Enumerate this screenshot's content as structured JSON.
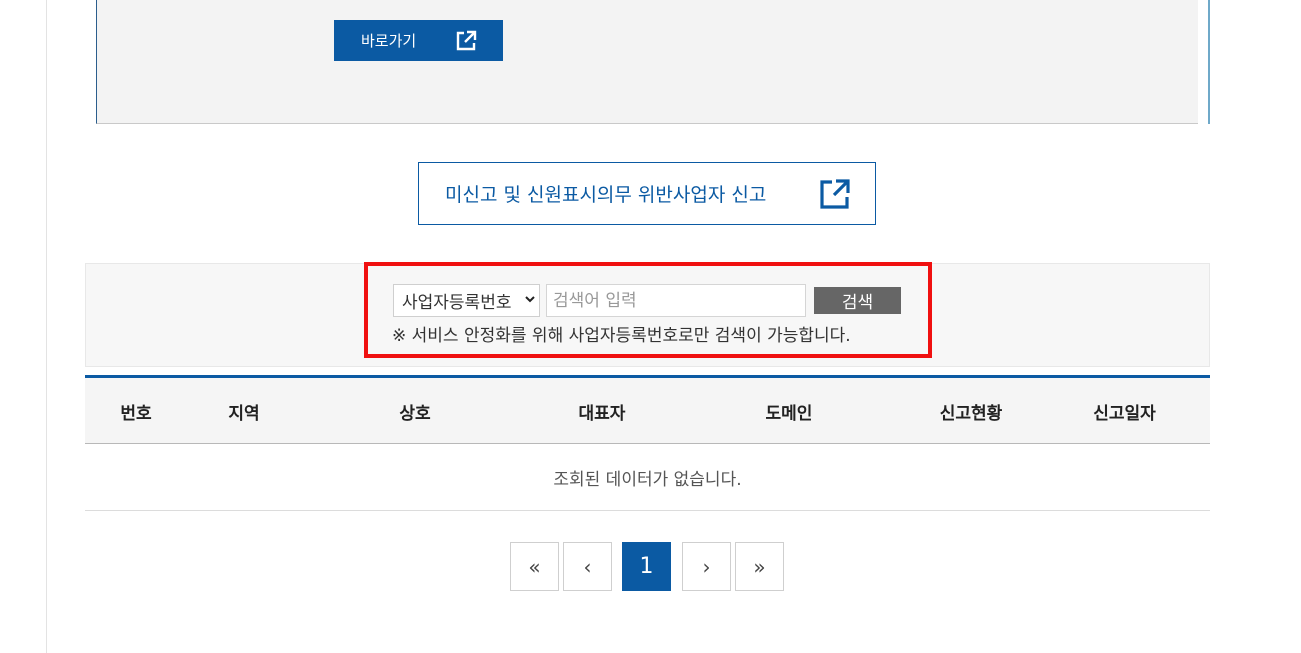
{
  "info_box": {
    "go_button_label": "바로가기",
    "go_icon": "external-link-icon"
  },
  "report_button": {
    "label": "미신고 및 신원표시의무 위반사업자 신고",
    "icon": "external-link-icon"
  },
  "search": {
    "select_value": "사업자등록번호",
    "input_placeholder": "검색어 입력",
    "input_value": "",
    "button_label": "검색",
    "note": "※ 서비스 안정화를 위해 사업자등록번호로만 검색이 가능합니다.",
    "highlight_color": "#f01010"
  },
  "table": {
    "columns": [
      "번호",
      "지역",
      "상호",
      "대표자",
      "도메인",
      "신고현황",
      "신고일자"
    ],
    "empty_message": "조회된 데이터가 없습니다."
  },
  "pagination": {
    "first_label": "«",
    "prev_label": "‹",
    "current_page": "1",
    "next_label": "›",
    "last_label": "»"
  },
  "colors": {
    "accent": "#0b5aa3",
    "search_button": "#666666"
  }
}
